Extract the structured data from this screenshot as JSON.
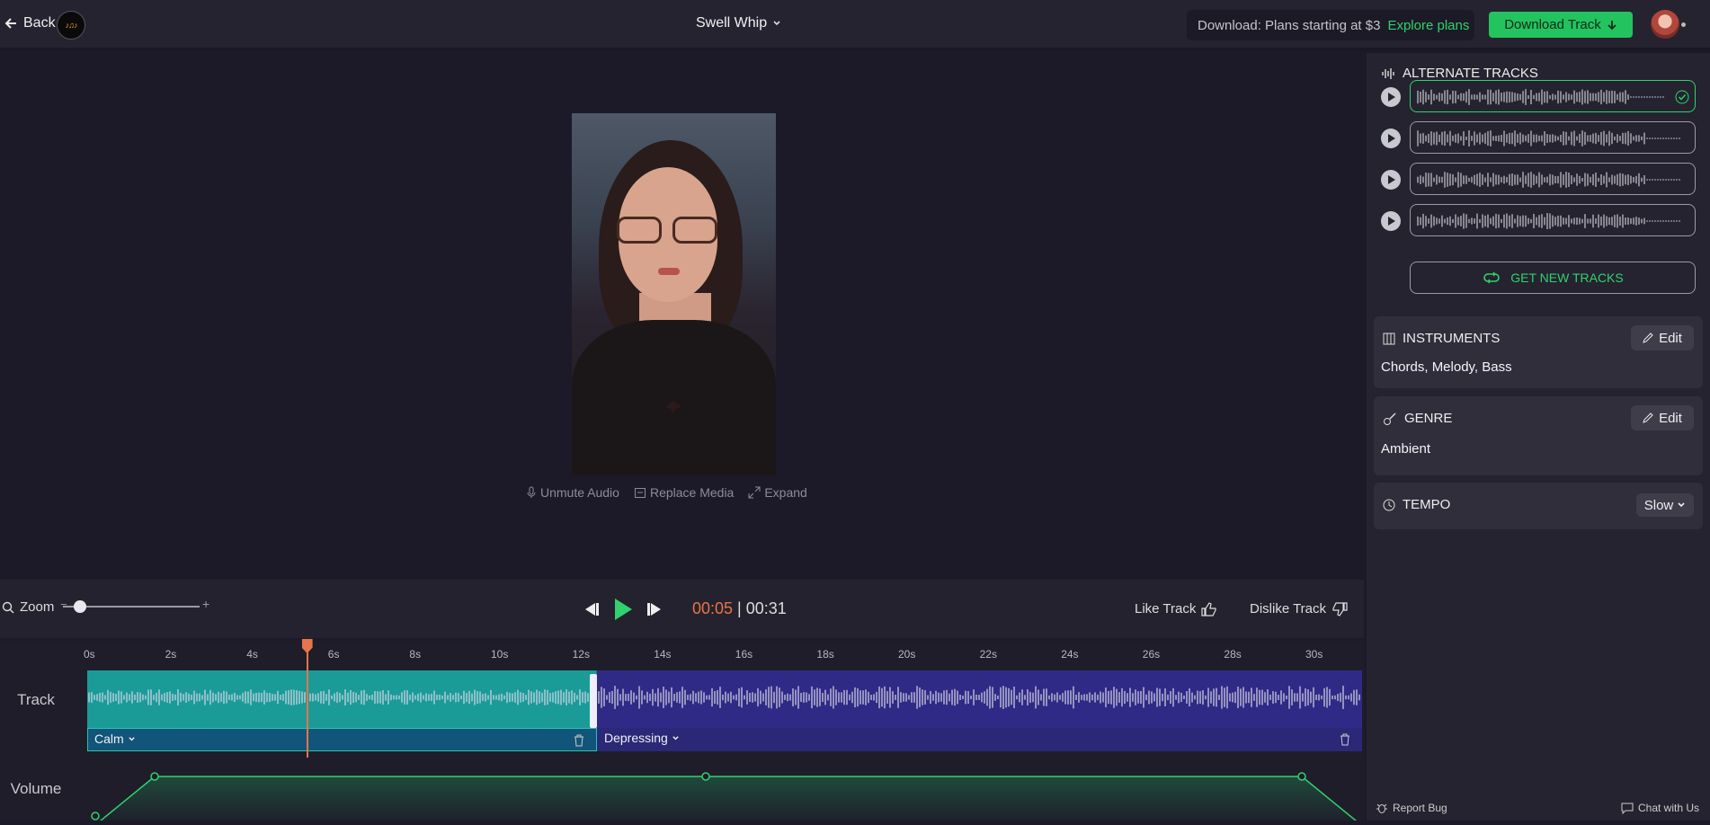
{
  "header": {
    "back_label": "Back",
    "logo_text": "♪♫♪",
    "project_title": "Swell Whip",
    "promo_text": "Download: Plans starting at $3",
    "explore_label": "Explore plans",
    "download_label": "Download Track"
  },
  "media": {
    "unmute_label": "Unmute Audio",
    "replace_label": "Replace Media",
    "expand_label": "Expand"
  },
  "controls": {
    "zoom_label": "Zoom",
    "zoom_minus": "−",
    "zoom_plus": "+",
    "zoom_level": 0.08,
    "time_current": "00:05",
    "time_sep": " | ",
    "time_total": "00:31",
    "like_label": "Like Track",
    "dislike_label": "Dislike Track"
  },
  "timeline": {
    "ticks": [
      "0s",
      "2s",
      "4s",
      "6s",
      "8s",
      "10s",
      "12s",
      "14s",
      "16s",
      "18s",
      "20s",
      "22s",
      "24s",
      "26s",
      "28s",
      "30s"
    ],
    "track_label": "Track",
    "volume_label": "Volume",
    "segments": [
      {
        "label": "Calm"
      },
      {
        "label": "Depressing"
      }
    ],
    "playhead_seconds": 5.4,
    "duration_seconds": 31
  },
  "panel": {
    "alt_tracks_title": "ALTERNATE TRACKS",
    "get_new_label": "GET NEW TRACKS",
    "instruments_title": "INSTRUMENTS",
    "instruments_value": "Chords, Melody, Bass",
    "genre_title": "GENRE",
    "genre_value": "Ambient",
    "tempo_title": "TEMPO",
    "tempo_value": "Slow",
    "edit_label": "Edit",
    "report_bug": "Report Bug",
    "chat": "Chat with Us"
  },
  "colors": {
    "accent_green": "#2fd26f",
    "playhead": "#e7744a",
    "calm_segment": "#1a9b98",
    "depressing_segment": "#2e2a85"
  }
}
